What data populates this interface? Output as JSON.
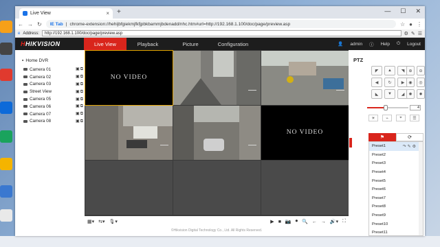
{
  "browser": {
    "tab_title": "Live View",
    "tab_close": "×",
    "new_tab": "+",
    "window_controls": [
      "—",
      "☐",
      "✕"
    ],
    "omnibox_prefix": "IE Tab",
    "omnibox_url": "chrome-extension://hehijbfgiekmjfkfjpbkbammjbdenadd/nhc.htm#url=http://192.168.1.100/doc/page/preview.asp",
    "address_label": "Address:",
    "address_url": "http://192.168.1.100/doc/page/preview.asp"
  },
  "app": {
    "logo": "HIKVISION",
    "menu": [
      "Live View",
      "Playback",
      "Picture",
      "Configuration"
    ],
    "user": "admin",
    "help": "Help",
    "logout": "Logout"
  },
  "tree": {
    "root": "Home DVR",
    "cameras": [
      "Camera 01",
      "Camera 02",
      "Camera 03",
      "Street View",
      "Camera 05",
      "Camera 06",
      "Camera 07",
      "Camera 08"
    ]
  },
  "grid": {
    "no_video": "NO VIDEO"
  },
  "ptz": {
    "title": "PTZ",
    "speed": "4",
    "presets": [
      "Preset1",
      "Preset2",
      "Preset3",
      "Preset4",
      "Preset5",
      "Preset6",
      "Preset7",
      "Preset8",
      "Preset9",
      "Preset10",
      "Preset11"
    ],
    "speed_level": 0.45
  },
  "footer": "©Hikvision Digital Technology Co., Ltd. All Rights Reserved.",
  "colors": {
    "accent": "#d9251c",
    "nav_bg": "#1d1d1d"
  }
}
